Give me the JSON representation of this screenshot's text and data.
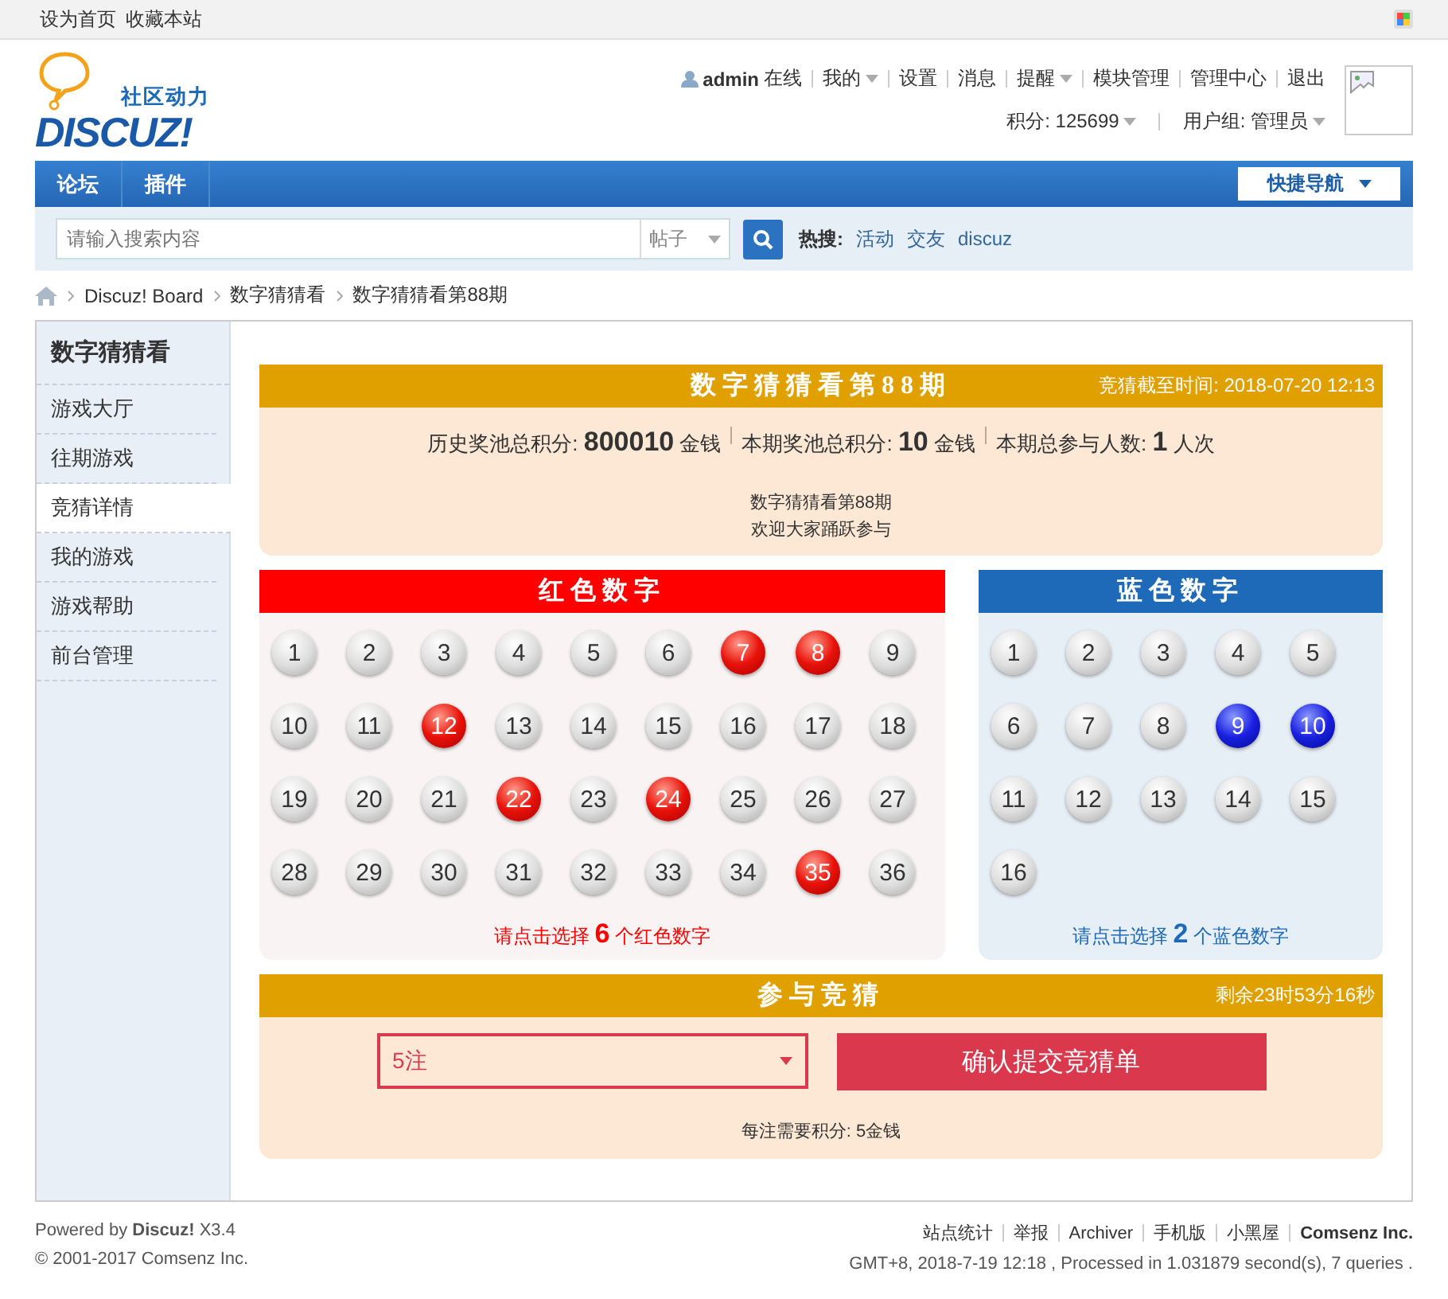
{
  "topbar": {
    "links": [
      "设为首页",
      "收藏本站"
    ]
  },
  "logo": {
    "tagline": "社区动力",
    "wordmark": "DISCUZ!"
  },
  "user": {
    "name": "admin",
    "status": "在线",
    "links": [
      {
        "label": "我的",
        "dropdown": true
      },
      {
        "label": "设置",
        "dropdown": false
      },
      {
        "label": "消息",
        "dropdown": false
      },
      {
        "label": "提醒",
        "dropdown": true
      },
      {
        "label": "模块管理",
        "dropdown": false
      },
      {
        "label": "管理中心",
        "dropdown": false
      },
      {
        "label": "退出",
        "dropdown": false
      }
    ],
    "credits": "积分: 125699",
    "group": "用户组: 管理员"
  },
  "nav": {
    "items": [
      "论坛",
      "插件"
    ],
    "quick_nav": "快捷导航"
  },
  "search": {
    "placeholder": "请输入搜索内容",
    "type": "帖子",
    "hot_label": "热搜:",
    "hot": [
      "活动",
      "交友",
      "discuz"
    ]
  },
  "breadcrumb": [
    "Discuz! Board",
    "数字猜猜看",
    "数字猜猜看第88期"
  ],
  "sidebar": {
    "title": "数字猜猜看",
    "items": [
      {
        "label": "游戏大厅",
        "selected": false
      },
      {
        "label": "往期游戏",
        "selected": false
      },
      {
        "label": "竞猜详情",
        "selected": true
      },
      {
        "label": "我的游戏",
        "selected": false
      },
      {
        "label": "游戏帮助",
        "selected": false
      },
      {
        "label": "前台管理",
        "selected": false
      }
    ]
  },
  "game": {
    "title": "数字猜猜看第88期",
    "deadline": "竞猜截至时间: 2018-07-20 12:13",
    "stats": [
      "历史奖池总积分: **800010** 金钱",
      "本期奖池总积分: **10** 金钱",
      "本期总参与人数: **1** 人次"
    ],
    "notice": [
      "数字猜猜看第88期",
      "欢迎大家踊跃参与"
    ]
  },
  "red": {
    "title": "红色数字",
    "hint": "请点击选择 **6** 个红色数字",
    "numbers": [
      {
        "label": "1",
        "selected": false
      },
      {
        "label": "2",
        "selected": false
      },
      {
        "label": "3",
        "selected": false
      },
      {
        "label": "4",
        "selected": false
      },
      {
        "label": "5",
        "selected": false
      },
      {
        "label": "6",
        "selected": false
      },
      {
        "label": "7",
        "selected": true
      },
      {
        "label": "8",
        "selected": true
      },
      {
        "label": "9",
        "selected": false
      },
      {
        "label": "10",
        "selected": false
      },
      {
        "label": "11",
        "selected": false
      },
      {
        "label": "12",
        "selected": true
      },
      {
        "label": "13",
        "selected": false
      },
      {
        "label": "14",
        "selected": false
      },
      {
        "label": "15",
        "selected": false
      },
      {
        "label": "16",
        "selected": false
      },
      {
        "label": "17",
        "selected": false
      },
      {
        "label": "18",
        "selected": false
      },
      {
        "label": "19",
        "selected": false
      },
      {
        "label": "20",
        "selected": false
      },
      {
        "label": "21",
        "selected": false
      },
      {
        "label": "22",
        "selected": true
      },
      {
        "label": "23",
        "selected": false
      },
      {
        "label": "24",
        "selected": true
      },
      {
        "label": "25",
        "selected": false
      },
      {
        "label": "26",
        "selected": false
      },
      {
        "label": "27",
        "selected": false
      },
      {
        "label": "28",
        "selected": false
      },
      {
        "label": "29",
        "selected": false
      },
      {
        "label": "30",
        "selected": false
      },
      {
        "label": "31",
        "selected": false
      },
      {
        "label": "32",
        "selected": false
      },
      {
        "label": "33",
        "selected": false
      },
      {
        "label": "34",
        "selected": false
      },
      {
        "label": "35",
        "selected": true
      },
      {
        "label": "36",
        "selected": false
      }
    ]
  },
  "blue": {
    "title": "蓝色数字",
    "hint": "请点击选择 **2** 个蓝色数字",
    "numbers": [
      {
        "label": "1",
        "selected": false
      },
      {
        "label": "2",
        "selected": false
      },
      {
        "label": "3",
        "selected": false
      },
      {
        "label": "4",
        "selected": false
      },
      {
        "label": "5",
        "selected": false
      },
      {
        "label": "6",
        "selected": false
      },
      {
        "label": "7",
        "selected": false
      },
      {
        "label": "8",
        "selected": false
      },
      {
        "label": "9",
        "selected": true
      },
      {
        "label": "10",
        "selected": true
      },
      {
        "label": "11",
        "selected": false
      },
      {
        "label": "12",
        "selected": false
      },
      {
        "label": "13",
        "selected": false
      },
      {
        "label": "14",
        "selected": false
      },
      {
        "label": "15",
        "selected": false
      },
      {
        "label": "16",
        "selected": false
      }
    ]
  },
  "bet": {
    "title": "参与竞猜",
    "remaining": "剩余23时53分16秒",
    "count": "5注",
    "submit": "确认提交竞猜单",
    "cost": "每注需要积分: 5金钱"
  },
  "footer": {
    "powered": "Powered by **Discuz!** X3.4",
    "copyright": "© 2001-2017 Comsenz Inc.",
    "links": [
      {
        "label": "站点统计",
        "bold": false
      },
      {
        "label": "举报",
        "bold": false
      },
      {
        "label": "Archiver",
        "bold": false
      },
      {
        "label": "手机版",
        "bold": false
      },
      {
        "label": "小黑屋",
        "bold": false
      },
      {
        "label": "Comsenz Inc.",
        "bold": true
      }
    ],
    "stats": "GMT+8, 2018-7-19 12:18 , Processed in 1.031879 second(s), 7 queries ."
  }
}
